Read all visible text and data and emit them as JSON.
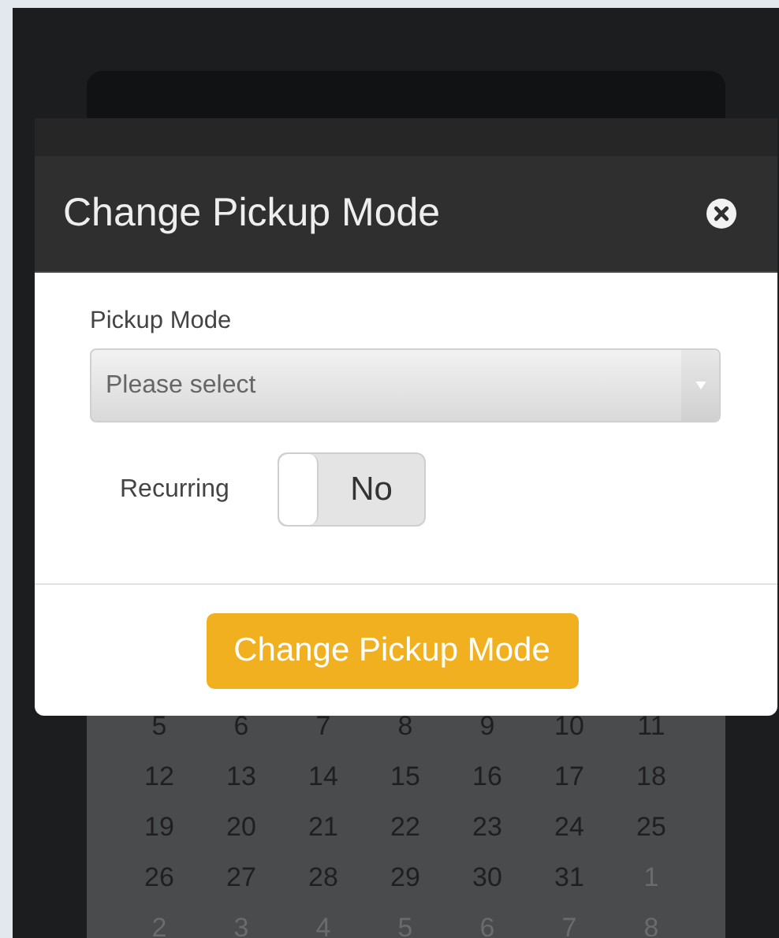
{
  "calendar": {
    "weeks": [
      [
        {
          "day": "5",
          "muted": false
        },
        {
          "day": "6",
          "muted": false
        },
        {
          "day": "7",
          "muted": false
        },
        {
          "day": "8",
          "muted": false
        },
        {
          "day": "9",
          "muted": false
        },
        {
          "day": "10",
          "muted": false
        },
        {
          "day": "11",
          "muted": false
        }
      ],
      [
        {
          "day": "12",
          "muted": false
        },
        {
          "day": "13",
          "muted": false
        },
        {
          "day": "14",
          "muted": false
        },
        {
          "day": "15",
          "muted": false
        },
        {
          "day": "16",
          "muted": false
        },
        {
          "day": "17",
          "muted": false
        },
        {
          "day": "18",
          "muted": false
        }
      ],
      [
        {
          "day": "19",
          "muted": false
        },
        {
          "day": "20",
          "muted": false
        },
        {
          "day": "21",
          "muted": false
        },
        {
          "day": "22",
          "muted": false
        },
        {
          "day": "23",
          "muted": false
        },
        {
          "day": "24",
          "muted": false
        },
        {
          "day": "25",
          "muted": false
        }
      ],
      [
        {
          "day": "26",
          "muted": false
        },
        {
          "day": "27",
          "muted": false
        },
        {
          "day": "28",
          "muted": false
        },
        {
          "day": "29",
          "muted": false
        },
        {
          "day": "30",
          "muted": false
        },
        {
          "day": "31",
          "muted": false
        },
        {
          "day": "1",
          "muted": true
        }
      ],
      [
        {
          "day": "2",
          "muted": true
        },
        {
          "day": "3",
          "muted": true
        },
        {
          "day": "4",
          "muted": true
        },
        {
          "day": "5",
          "muted": true
        },
        {
          "day": "6",
          "muted": true
        },
        {
          "day": "7",
          "muted": true
        },
        {
          "day": "8",
          "muted": true
        }
      ]
    ]
  },
  "modal": {
    "title": "Change Pickup Mode",
    "field": {
      "label": "Pickup Mode",
      "placeholder": "Please select"
    },
    "recurring": {
      "label": "Recurring",
      "on": false,
      "value": "No"
    },
    "submit": "Change Pickup Mode"
  }
}
